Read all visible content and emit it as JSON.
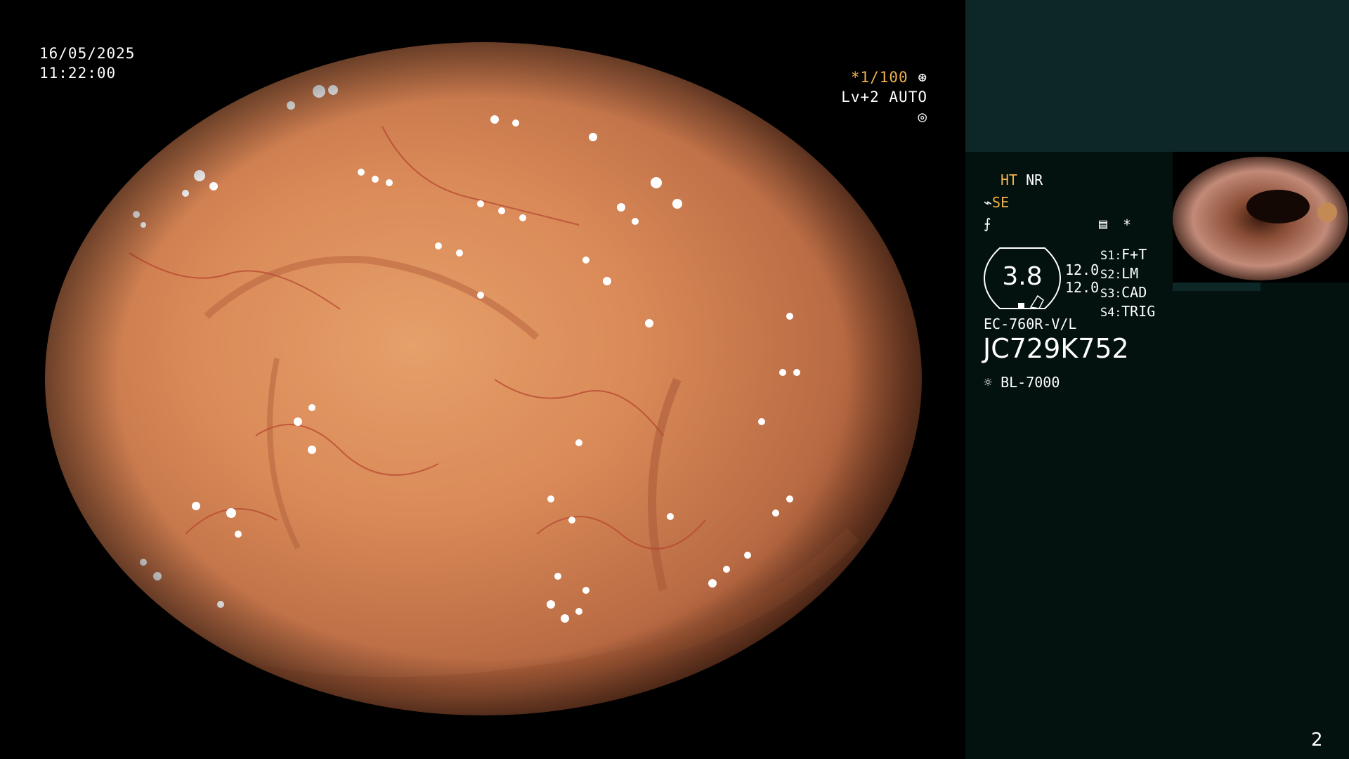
{
  "header": {
    "date": "16/05/2025",
    "time": "11:22:00"
  },
  "overlay": {
    "shutter_speed": "*1/100",
    "shutter_icon": "aperture-icon",
    "level": "Lv+2 AUTO",
    "level_icon": "iris-icon"
  },
  "settings": {
    "ht_label": "HT",
    "nr_label": "NR",
    "se_label": "SE",
    "se_icon": "structure-enhancement-icon",
    "color_icon": "color-mode-icon",
    "menu_icon": "menu-list-icon",
    "asterisk": "*"
  },
  "dial": {
    "value": "3.8"
  },
  "channel_values": [
    "12.0",
    "12.0"
  ],
  "switches": [
    {
      "key": "S1",
      "value": "F+T"
    },
    {
      "key": "S2",
      "value": "LM"
    },
    {
      "key": "S3",
      "value": "CAD"
    },
    {
      "key": "S4",
      "value": "TRIG"
    }
  ],
  "scope": {
    "model": "EC-760R-V/L",
    "serial": "JC729K752",
    "light_source": "BL-7000",
    "light_icon": "light-source-icon"
  },
  "page_number": "2",
  "colors": {
    "accent": "#f0b34a",
    "panel_bg": "#03110f",
    "panel_top_bg": "#0c2726",
    "tissue": "#d9895c"
  }
}
